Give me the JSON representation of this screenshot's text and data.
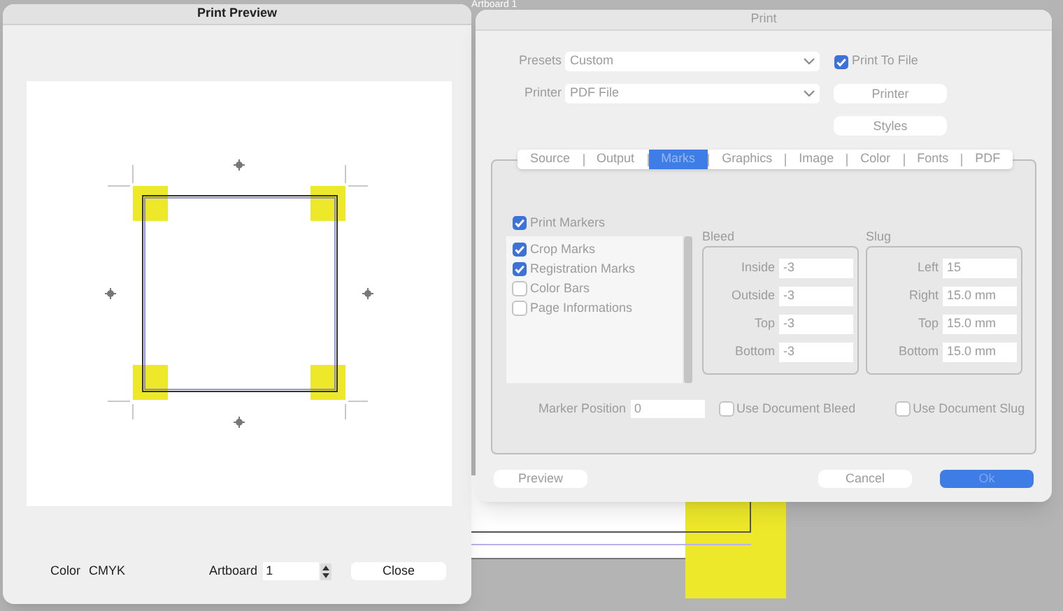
{
  "background": {
    "artboard_label": "Artboard 1"
  },
  "preview_window": {
    "title": "Print Preview",
    "color_label": "Color",
    "color_value": "CMYK",
    "artboard_label": "Artboard",
    "artboard_value": "1",
    "close_button": "Close"
  },
  "print_window": {
    "title": "Print",
    "presets": {
      "label": "Presets",
      "value": "Custom"
    },
    "printer": {
      "label": "Printer",
      "value": "PDF File"
    },
    "print_to_file": {
      "label": "Print To File",
      "checked": true
    },
    "side_buttons": [
      "Printer",
      "Styles"
    ],
    "tabs": [
      {
        "label": "Source",
        "selected": false
      },
      {
        "label": "Output",
        "selected": false
      },
      {
        "label": "Marks",
        "selected": true
      },
      {
        "label": "Graphics",
        "selected": false
      },
      {
        "label": "Image",
        "selected": false
      },
      {
        "label": "Color",
        "selected": false
      },
      {
        "label": "Fonts",
        "selected": false
      },
      {
        "label": "PDF",
        "selected": false
      }
    ],
    "print_markers": {
      "label": "Print Markers",
      "checked": true
    },
    "markers": [
      {
        "label": "Crop Marks",
        "checked": true
      },
      {
        "label": "Registration Marks",
        "checked": true
      },
      {
        "label": "Color Bars",
        "checked": false
      },
      {
        "label": "Page Informations",
        "checked": false
      }
    ],
    "bleed": {
      "title": "Bleed",
      "fields": [
        {
          "label": "Inside",
          "value": "-3"
        },
        {
          "label": "Outside",
          "value": "-3"
        },
        {
          "label": "Top",
          "value": "-3"
        },
        {
          "label": "Bottom",
          "value": "-3"
        }
      ]
    },
    "slug": {
      "title": "Slug",
      "fields": [
        {
          "label": "Left",
          "value": "15"
        },
        {
          "label": "Right",
          "value": "15.0 mm"
        },
        {
          "label": "Top",
          "value": "15.0 mm"
        },
        {
          "label": "Bottom",
          "value": "15.0 mm"
        }
      ]
    },
    "marker_position": {
      "label": "Marker Position",
      "value": "0"
    },
    "options": [
      {
        "label": "Use Document Bleed",
        "checked": false
      },
      {
        "label": "Use Document Slug",
        "checked": false
      }
    ],
    "footer_buttons": [
      {
        "label": "Preview",
        "kind": "plain"
      },
      {
        "label": "Cancel",
        "kind": "plain"
      },
      {
        "label": "Ok",
        "kind": "default"
      }
    ]
  }
}
